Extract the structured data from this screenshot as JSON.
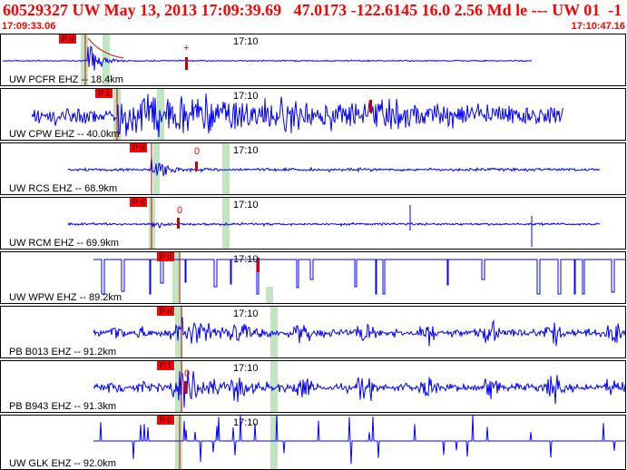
{
  "header": {
    "title": "60529327 UW May 13, 2013 17:09:39.69   47.0173 -122.6145 16.0 2.56 Md le --- UW 01  -1",
    "start_time": "17:09:33.06",
    "end_time": "17:10:47.16",
    "colors": {
      "header_text": "#ff0000",
      "trace": "#0000ff",
      "pick": "#ff0000",
      "window": "#bfe6bf"
    }
  },
  "traces": [
    {
      "label": "UW PCFR EHZ -- 18.4km",
      "tick": "17:10",
      "pick_label": "P d",
      "amp_mark": "+"
    },
    {
      "label": "UW CPW EHZ -- 40.0km",
      "tick": "17:10",
      "pick_label": "P 1",
      "amp_mark": ""
    },
    {
      "label": "UW RCS EHZ -- 68.9km",
      "tick": "17:10",
      "pick_label": "P d",
      "amp_mark": "0"
    },
    {
      "label": "UW RCM EHZ -- 69.9km",
      "tick": "17:10",
      "pick_label": "P d",
      "amp_mark": "0"
    },
    {
      "label": "UW WPW EHZ -- 89.2km",
      "tick": "17:10",
      "pick_label": "P d",
      "amp_mark": ""
    },
    {
      "label": "PB B013 EHZ -- 91.2km",
      "tick": "17:10",
      "pick_label": "P d",
      "amp_mark": ""
    },
    {
      "label": "PB B943 EHZ -- 91.3km",
      "tick": "17:10",
      "pick_label": "P 1",
      "amp_mark": "0"
    },
    {
      "label": "UW GLK EHZ -- 92.0km",
      "tick": "17:10",
      "pick_label": "P 0",
      "amp_mark": ""
    }
  ]
}
